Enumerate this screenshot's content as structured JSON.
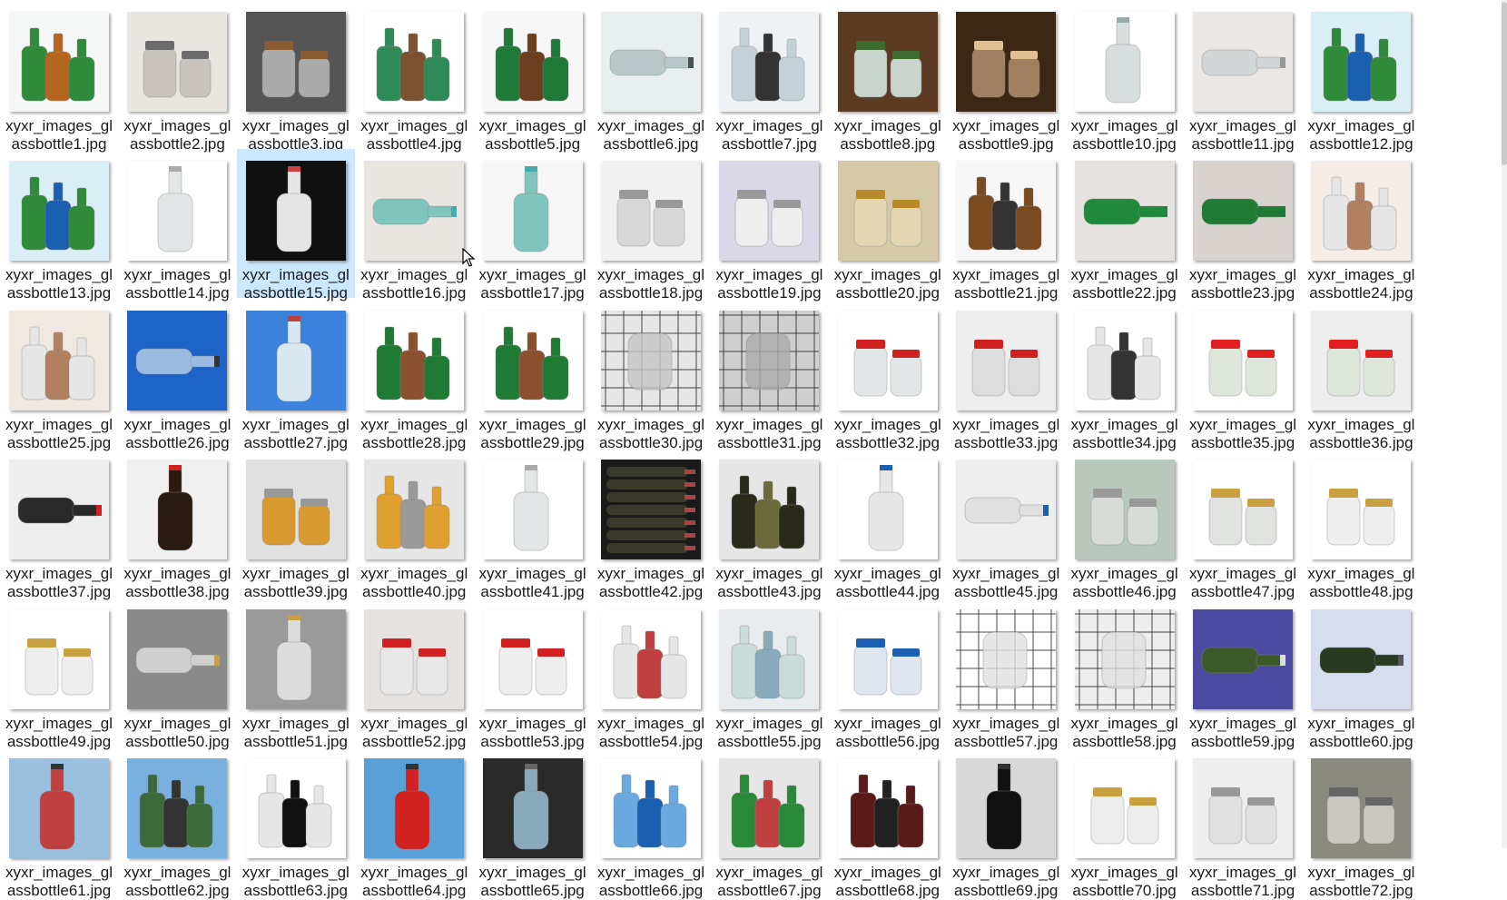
{
  "window": {
    "view": "Large icons"
  },
  "selected_index": 14,
  "files": [
    {
      "name": "xyxr_images_glassbottle1.jpg",
      "bg": "#f4f7f6",
      "fg": "#2f8a3a",
      "accent": "#b5651d",
      "kind": "bottles"
    },
    {
      "name": "xyxr_images_glassbottle2.jpg",
      "bg": "#e9e6e2",
      "fg": "#c9c3bd",
      "accent": "#6b6b6b",
      "kind": "jars"
    },
    {
      "name": "xyxr_images_glassbottle3.jpg",
      "bg": "#555555",
      "fg": "#aaaaaa",
      "accent": "#8a5a30",
      "kind": "jars"
    },
    {
      "name": "xyxr_images_glassbottle4.jpg",
      "bg": "#ffffff",
      "fg": "#2e8b57",
      "accent": "#7a5230",
      "kind": "bottles"
    },
    {
      "name": "xyxr_images_glassbottle5.jpg",
      "bg": "#f7f7f7",
      "fg": "#1f7a3a",
      "accent": "#6b3f20",
      "kind": "bottles"
    },
    {
      "name": "xyxr_images_glassbottle6.jpg",
      "bg": "#e9eeee",
      "fg": "#b8c8c8",
      "accent": "#445555",
      "kind": "bottle-h"
    },
    {
      "name": "xyxr_images_glassbottle7.jpg",
      "bg": "#eef2f4",
      "fg": "#c4d2d8",
      "accent": "#333333",
      "kind": "bottles"
    },
    {
      "name": "xyxr_images_glassbottle8.jpg",
      "bg": "#5c3b22",
      "fg": "#c8d4cc",
      "accent": "#3e6b2e",
      "kind": "jars"
    },
    {
      "name": "xyxr_images_glassbottle9.jpg",
      "bg": "#3c2614",
      "fg": "#a08060",
      "accent": "#e0c090",
      "kind": "jars"
    },
    {
      "name": "xyxr_images_glassbottle10.jpg",
      "bg": "#ffffff",
      "fg": "#d8dddd",
      "accent": "#9aa",
      "kind": "bottle"
    },
    {
      "name": "xyxr_images_glassbottle11.jpg",
      "bg": "#ebe7e4",
      "fg": "#d2d6d6",
      "accent": "#999",
      "kind": "bottle-h"
    },
    {
      "name": "xyxr_images_glassbottle12.jpg",
      "bg": "#d9eef5",
      "fg": "#2f8a3a",
      "accent": "#1b5fb0",
      "kind": "bottles"
    },
    {
      "name": "xyxr_images_glassbottle13.jpg",
      "bg": "#d9eef5",
      "fg": "#2f8a3a",
      "accent": "#1b5fb0",
      "kind": "bottles"
    },
    {
      "name": "xyxr_images_glassbottle14.jpg",
      "bg": "#ffffff",
      "fg": "#e3e6e6",
      "accent": "#aaa",
      "kind": "bottle"
    },
    {
      "name": "xyxr_images_glassbottle15.jpg",
      "bg": "#101010",
      "fg": "#e6e6e6",
      "accent": "#d04040",
      "kind": "bottle"
    },
    {
      "name": "xyxr_images_glassbottle16.jpg",
      "bg": "#e9e6e2",
      "fg": "#7fc4bd",
      "accent": "#4aa",
      "kind": "bottle-h"
    },
    {
      "name": "xyxr_images_glassbottle17.jpg",
      "bg": "#f6f6f6",
      "fg": "#7fc4bd",
      "accent": "#4aa",
      "kind": "bottle"
    },
    {
      "name": "xyxr_images_glassbottle18.jpg",
      "bg": "#f1f1f1",
      "fg": "#d8d8d8",
      "accent": "#999",
      "kind": "jars"
    },
    {
      "name": "xyxr_images_glassbottle19.jpg",
      "bg": "#dad7e6",
      "fg": "#eeeeee",
      "accent": "#999",
      "kind": "jars"
    },
    {
      "name": "xyxr_images_glassbottle20.jpg",
      "bg": "#d6c9a8",
      "fg": "#e3d6b0",
      "accent": "#b88a2a",
      "kind": "jars"
    },
    {
      "name": "xyxr_images_glassbottle21.jpg",
      "bg": "#f6f6f6",
      "fg": "#7a4a20",
      "accent": "#333",
      "kind": "bottles"
    },
    {
      "name": "xyxr_images_glassbottle22.jpg",
      "bg": "#e6e2e0",
      "fg": "#1f8a3a",
      "accent": "#1f8a3a",
      "kind": "bottle-h"
    },
    {
      "name": "xyxr_images_glassbottle23.jpg",
      "bg": "#d9d3cf",
      "fg": "#1f7a34",
      "accent": "#1f7a34",
      "kind": "bottle-h"
    },
    {
      "name": "xyxr_images_glassbottle24.jpg",
      "bg": "#f5eee8",
      "fg": "#e6e6e6",
      "accent": "#b08060",
      "kind": "bottles"
    },
    {
      "name": "xyxr_images_glassbottle25.jpg",
      "bg": "#f0e9e2",
      "fg": "#e6e6e6",
      "accent": "#b08060",
      "kind": "bottles"
    },
    {
      "name": "xyxr_images_glassbottle26.jpg",
      "bg": "#1e64c8",
      "fg": "#9bbbe0",
      "accent": "#333",
      "kind": "bottle-h"
    },
    {
      "name": "xyxr_images_glassbottle27.jpg",
      "bg": "#3c82dc",
      "fg": "#d8e8f0",
      "accent": "#c04040",
      "kind": "bottle"
    },
    {
      "name": "xyxr_images_glassbottle28.jpg",
      "bg": "#ffffff",
      "fg": "#1f7a34",
      "accent": "#8a5030",
      "kind": "bottles"
    },
    {
      "name": "xyxr_images_glassbottle29.jpg",
      "bg": "#ffffff",
      "fg": "#1f7a34",
      "accent": "#8a5030",
      "kind": "bottles"
    },
    {
      "name": "xyxr_images_glassbottle30.jpg",
      "bg": "#e6e6e6",
      "fg": "#c4c4c4",
      "accent": "#333",
      "kind": "grid"
    },
    {
      "name": "xyxr_images_glassbottle31.jpg",
      "bg": "#cfcfcf",
      "fg": "#aaaaaa",
      "accent": "#333",
      "kind": "grid"
    },
    {
      "name": "xyxr_images_glassbottle32.jpg",
      "bg": "#ffffff",
      "fg": "#e3e6e6",
      "accent": "#d02020",
      "kind": "jars"
    },
    {
      "name": "xyxr_images_glassbottle33.jpg",
      "bg": "#eeeeee",
      "fg": "#dddddd",
      "accent": "#d02020",
      "kind": "jars"
    },
    {
      "name": "xyxr_images_glassbottle34.jpg",
      "bg": "#ffffff",
      "fg": "#e6e6e6",
      "accent": "#333",
      "kind": "bottles"
    },
    {
      "name": "xyxr_images_glassbottle35.jpg",
      "bg": "#ffffff",
      "fg": "#dfe6dc",
      "accent": "#e02020",
      "kind": "jars"
    },
    {
      "name": "xyxr_images_glassbottle36.jpg",
      "bg": "#eeeeee",
      "fg": "#dfe6dc",
      "accent": "#e02020",
      "kind": "jars"
    },
    {
      "name": "xyxr_images_glassbottle37.jpg",
      "bg": "#eeeeee",
      "fg": "#2a2a2a",
      "accent": "#d02020",
      "kind": "bottle-h"
    },
    {
      "name": "xyxr_images_glassbottle38.jpg",
      "bg": "#f0f0f0",
      "fg": "#2a1a10",
      "accent": "#d02020",
      "kind": "bottle"
    },
    {
      "name": "xyxr_images_glassbottle39.jpg",
      "bg": "#e0e0e0",
      "fg": "#d89a30",
      "accent": "#999",
      "kind": "jars"
    },
    {
      "name": "xyxr_images_glassbottle40.jpg",
      "bg": "#e6e6e6",
      "fg": "#e0a030",
      "accent": "#999",
      "kind": "bottles"
    },
    {
      "name": "xyxr_images_glassbottle41.jpg",
      "bg": "#ffffff",
      "fg": "#e3e6e6",
      "accent": "#aaa",
      "kind": "bottle"
    },
    {
      "name": "xyxr_images_glassbottle42.jpg",
      "bg": "#1a1a1a",
      "fg": "#3a3a2a",
      "accent": "#aa4444",
      "kind": "stack"
    },
    {
      "name": "xyxr_images_glassbottle43.jpg",
      "bg": "#e6e6e6",
      "fg": "#2a2a1a",
      "accent": "#6a6a3a",
      "kind": "bottles"
    },
    {
      "name": "xyxr_images_glassbottle44.jpg",
      "bg": "#ffffff",
      "fg": "#e6e6e6",
      "accent": "#1b5fb0",
      "kind": "bottle"
    },
    {
      "name": "xyxr_images_glassbottle45.jpg",
      "bg": "#eeeeee",
      "fg": "#e0e0e0",
      "accent": "#1b5fb0",
      "kind": "bottle-h"
    },
    {
      "name": "xyxr_images_glassbottle46.jpg",
      "bg": "#b8c8bc",
      "fg": "#d8dcd8",
      "accent": "#999",
      "kind": "jars"
    },
    {
      "name": "xyxr_images_glassbottle47.jpg",
      "bg": "#ffffff",
      "fg": "#dfe2df",
      "accent": "#c8a040",
      "kind": "jars"
    },
    {
      "name": "xyxr_images_glassbottle48.jpg",
      "bg": "#ffffff",
      "fg": "#eee",
      "accent": "#c8a040",
      "kind": "jars"
    },
    {
      "name": "xyxr_images_glassbottle49.jpg",
      "bg": "#ffffff",
      "fg": "#eee",
      "accent": "#c8a040",
      "kind": "jars"
    },
    {
      "name": "xyxr_images_glassbottle50.jpg",
      "bg": "#8a8a8a",
      "fg": "#cfcfcf",
      "accent": "#c8a040",
      "kind": "bottle-h"
    },
    {
      "name": "xyxr_images_glassbottle51.jpg",
      "bg": "#9a9a9a",
      "fg": "#dcdcdc",
      "accent": "#c8a040",
      "kind": "bottle"
    },
    {
      "name": "xyxr_images_glassbottle52.jpg",
      "bg": "#e6e2e0",
      "fg": "#e8e8e8",
      "accent": "#d02020",
      "kind": "jars"
    },
    {
      "name": "xyxr_images_glassbottle53.jpg",
      "bg": "#ffffff",
      "fg": "#eee",
      "accent": "#d02020",
      "kind": "jars"
    },
    {
      "name": "xyxr_images_glassbottle54.jpg",
      "bg": "#ffffff",
      "fg": "#e6e6e6",
      "accent": "#c04040",
      "kind": "bottles"
    },
    {
      "name": "xyxr_images_glassbottle55.jpg",
      "bg": "#e8ecef",
      "fg": "#c8dcd8",
      "accent": "#8ab",
      "kind": "bottles"
    },
    {
      "name": "xyxr_images_glassbottle56.jpg",
      "bg": "#ffffff",
      "fg": "#dfe6ef",
      "accent": "#1b5fb0",
      "kind": "jars"
    },
    {
      "name": "xyxr_images_glassbottle57.jpg",
      "bg": "#ffffff",
      "fg": "#e0e0e0",
      "accent": "#333",
      "kind": "grid"
    },
    {
      "name": "xyxr_images_glassbottle58.jpg",
      "bg": "#eeeeee",
      "fg": "#e0e0e0",
      "accent": "#333",
      "kind": "grid"
    },
    {
      "name": "xyxr_images_glassbottle59.jpg",
      "bg": "#4a4aa0",
      "fg": "#3a5a2a",
      "accent": "#dddddd",
      "kind": "bottle-h"
    },
    {
      "name": "xyxr_images_glassbottle60.jpg",
      "bg": "#d8dcef",
      "fg": "#2a3a20",
      "accent": "#555",
      "kind": "bottle-h"
    },
    {
      "name": "xyxr_images_glassbottle61.jpg",
      "bg": "#9ac0e0",
      "fg": "#c04040",
      "accent": "#333",
      "kind": "bottle"
    },
    {
      "name": "xyxr_images_glassbottle62.jpg",
      "bg": "#7ab0e0",
      "fg": "#3a6a3a",
      "accent": "#333",
      "kind": "bottles"
    },
    {
      "name": "xyxr_images_glassbottle63.jpg",
      "bg": "#ffffff",
      "fg": "#e6e6e6",
      "accent": "#111",
      "kind": "bottles"
    },
    {
      "name": "xyxr_images_glassbottle64.jpg",
      "bg": "#5aa0d8",
      "fg": "#d02020",
      "accent": "#333",
      "kind": "bottle"
    },
    {
      "name": "xyxr_images_glassbottle65.jpg",
      "bg": "#2a2a2a",
      "fg": "#8ab",
      "accent": "#666",
      "kind": "bottle"
    },
    {
      "name": "xyxr_images_glassbottle66.jpg",
      "bg": "#ffffff",
      "fg": "#6aa8e0",
      "accent": "#1b5fb0",
      "kind": "bottles"
    },
    {
      "name": "xyxr_images_glassbottle67.jpg",
      "bg": "#e6e6e6",
      "fg": "#2a8a3a",
      "accent": "#c04040",
      "kind": "bottles"
    },
    {
      "name": "xyxr_images_glassbottle68.jpg",
      "bg": "#ffffff",
      "fg": "#5a1a1a",
      "accent": "#222",
      "kind": "bottles"
    },
    {
      "name": "xyxr_images_glassbottle69.jpg",
      "bg": "#d8d8d8",
      "fg": "#111111",
      "accent": "#333",
      "kind": "bottle"
    },
    {
      "name": "xyxr_images_glassbottle70.jpg",
      "bg": "#ffffff",
      "fg": "#eee",
      "accent": "#c8a040",
      "kind": "jars"
    },
    {
      "name": "xyxr_images_glassbottle71.jpg",
      "bg": "#eeeeee",
      "fg": "#e0e0e0",
      "accent": "#999",
      "kind": "jars"
    },
    {
      "name": "xyxr_images_glassbottle72.jpg",
      "bg": "#8a8a80",
      "fg": "#c8c8c0",
      "accent": "#666",
      "kind": "jars"
    }
  ]
}
